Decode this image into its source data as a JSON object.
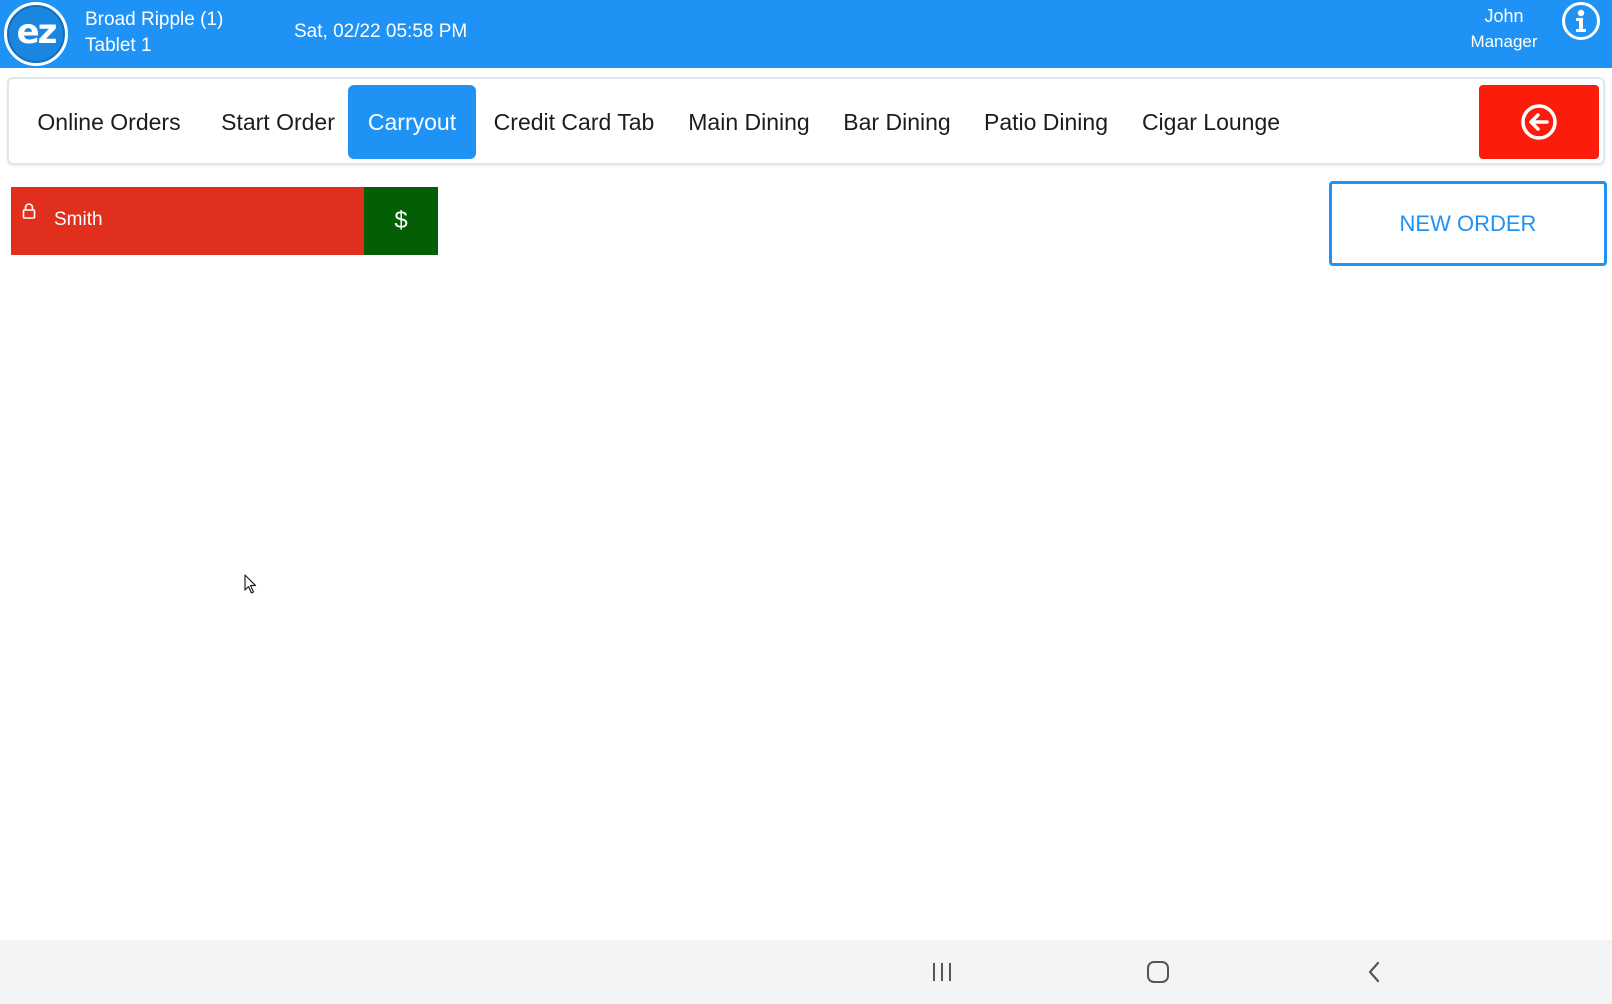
{
  "header": {
    "logo_text": "ez",
    "location_line1": "Broad Ripple (1)",
    "location_line2": "Tablet 1",
    "datetime": "Sat, 02/22 05:58 PM",
    "user_name": "John",
    "user_role": "Manager",
    "info_icon": "info-icon"
  },
  "nav": {
    "tabs": [
      {
        "label": "Online Orders",
        "active": false
      },
      {
        "label": "Start Order",
        "active": false
      },
      {
        "label": "Carryout",
        "active": true
      },
      {
        "label": "Credit Card Tab",
        "active": false
      },
      {
        "label": "Main Dining",
        "active": false
      },
      {
        "label": "Bar Dining",
        "active": false
      },
      {
        "label": "Patio Dining",
        "active": false
      },
      {
        "label": "Cigar Lounge",
        "active": false
      }
    ],
    "back_icon": "back-arrow-circle-icon"
  },
  "orders": [
    {
      "name": "Smith",
      "locked": true,
      "pay_label": "$"
    }
  ],
  "new_order_label": "NEW ORDER",
  "system_nav": {
    "recents_icon": "recents-icon",
    "home_icon": "home-icon",
    "back_icon": "back-chevron-icon"
  },
  "colors": {
    "primary": "#1e93f5",
    "danger": "#fb1c0c",
    "order_red": "#e02f1d",
    "pay_green": "#045e06"
  }
}
